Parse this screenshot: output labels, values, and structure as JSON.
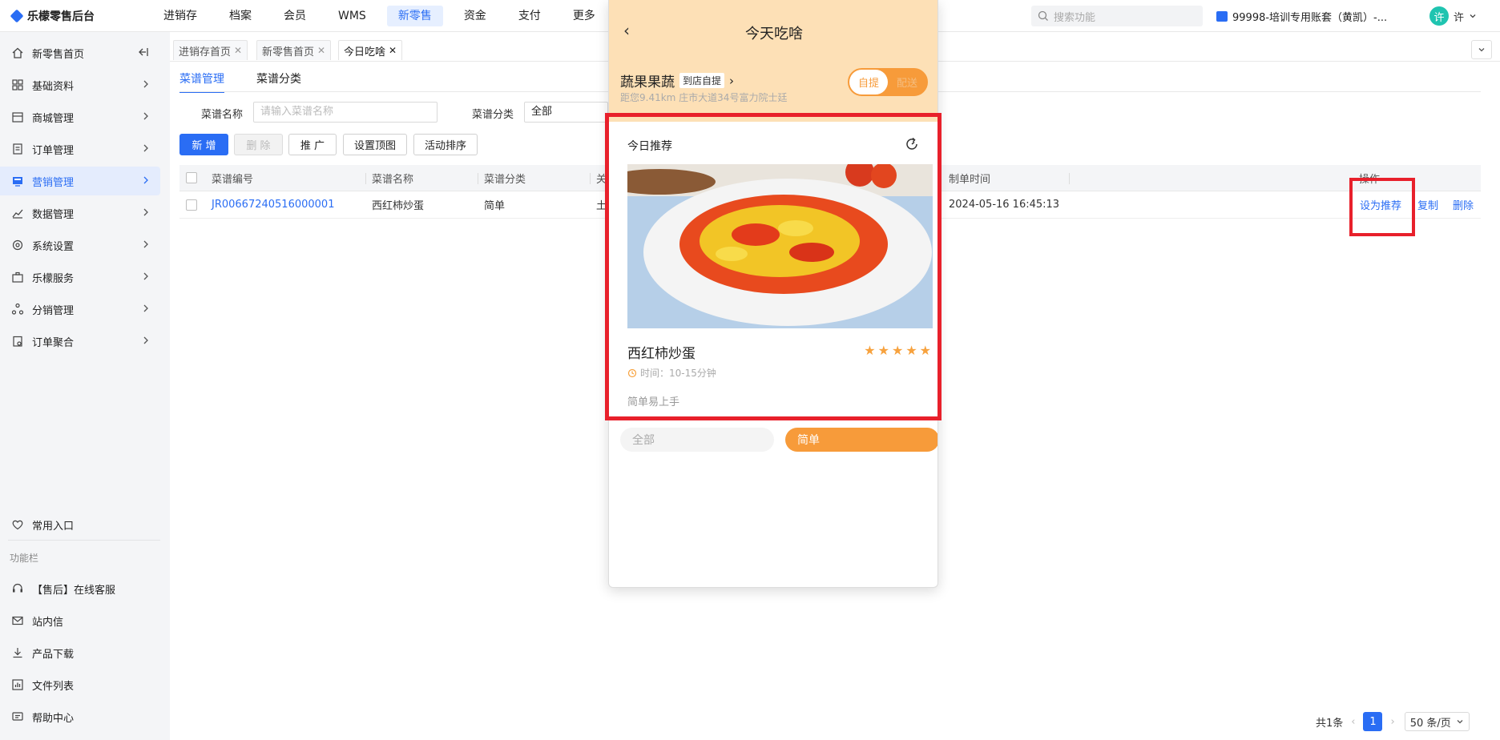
{
  "app": {
    "name": "乐檬零售后台"
  },
  "topnav": [
    {
      "label": "进销存"
    },
    {
      "label": "档案"
    },
    {
      "label": "会员"
    },
    {
      "label": "WMS"
    },
    {
      "label": "新零售"
    },
    {
      "label": "资金"
    },
    {
      "label": "支付"
    },
    {
      "label": "更多"
    }
  ],
  "search": {
    "placeholder": "搜索功能"
  },
  "account": {
    "label": "99998-培训专用账套（黄凯）-..."
  },
  "user": {
    "avatar": "许",
    "name": "许"
  },
  "sidebar": {
    "items": [
      {
        "label": "新零售首页"
      },
      {
        "label": "基础资料"
      },
      {
        "label": "商城管理"
      },
      {
        "label": "订单管理"
      },
      {
        "label": "营销管理"
      },
      {
        "label": "数据管理"
      },
      {
        "label": "系统设置"
      },
      {
        "label": "乐檬服务"
      },
      {
        "label": "分销管理"
      },
      {
        "label": "订单聚合"
      }
    ],
    "common_entry": "常用入口",
    "section_title": "功能栏",
    "tools": [
      {
        "label": "【售后】在线客服"
      },
      {
        "label": "站内信"
      },
      {
        "label": "产品下载"
      },
      {
        "label": "文件列表"
      },
      {
        "label": "帮助中心"
      }
    ]
  },
  "page_tabs": [
    {
      "label": "进销存首页"
    },
    {
      "label": "新零售首页"
    },
    {
      "label": "今日吃啥"
    }
  ],
  "subtabs": [
    {
      "label": "菜谱管理"
    },
    {
      "label": "菜谱分类"
    }
  ],
  "filters": {
    "name_label": "菜谱名称",
    "name_placeholder": "请输入菜谱名称",
    "category_label": "菜谱分类",
    "category_value": "全部"
  },
  "toolbar": {
    "add": "新 增",
    "delete": "删 除",
    "promote": "推 广",
    "set_top_image": "设置顶图",
    "activity_sort": "活动排序"
  },
  "table": {
    "headers": {
      "code": "菜谱编号",
      "name": "菜谱名称",
      "category": "菜谱分类",
      "col4": "关",
      "created": "制单时间",
      "actions": "操作"
    },
    "rows": [
      {
        "code": "JR00667240516000001",
        "name": "西红柿炒蛋",
        "category": "简单",
        "col4": "土",
        "created": "2024-05-16 16:45:13",
        "actions": {
          "recommend": "设为推荐",
          "copy": "复制",
          "delete": "删除"
        }
      }
    ]
  },
  "pagination": {
    "total": "共1条",
    "current_page": "1",
    "page_size": "50 条/页"
  },
  "preview": {
    "title": "今天吃啥",
    "store_name": "蔬果果蔬",
    "store_tag": "到店自提",
    "store_address": "距您9.41km 庄市大道34号富力院士廷",
    "toggle_on": "自提",
    "toggle_off": "配送",
    "card": {
      "heading": "今日推荐",
      "dish_name": "西红柿炒蛋",
      "rating": 5,
      "time": "时间：10-15分钟",
      "description": "简单易上手"
    },
    "categories": [
      {
        "label": "全部"
      },
      {
        "label": "简单"
      }
    ]
  },
  "colors": {
    "primary": "#2a6df4",
    "accent_orange": "#f79b3a",
    "highlight_red": "#e8202b",
    "header_bg": "#fde0b6"
  }
}
